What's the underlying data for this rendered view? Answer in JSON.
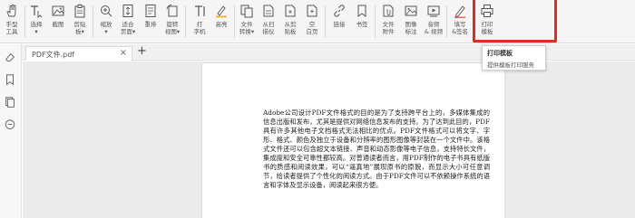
{
  "toolbar": {
    "hand_label": "手型\n工具",
    "select_label": "选择\n▾",
    "screenshot_label": "截图",
    "clipboard_label": "剪贴\n板▾",
    "zoom_label": "缩放\n▾",
    "fitpage_label": "适合\n页面▾",
    "reflow_label": "重排",
    "rotate_label": "旋转\n视图▾",
    "typewriter_label": "打\n字机",
    "highlight_label": "高亮",
    "convert_label": "文件\n转换▾",
    "from_scanner_label": "从扫\n描仪",
    "from_clipboard_label": "从剪\n贴板",
    "blank_page_label": "空\n白页",
    "link_label": "链接",
    "bookmark_label": "书签",
    "attach_label": "文件\n附件",
    "image_label": "图像\n标注",
    "audio_video_label": "音频\n& 视频",
    "sign_label": "填写\n&签名",
    "print_template_label": "打印\n模板"
  },
  "tabs": {
    "file_name": "PDF文件.pdf",
    "close": "×",
    "add": "+"
  },
  "tooltip": {
    "title": "打印模板",
    "description": "提供模板打印服务"
  },
  "document": {
    "body": "Adobe公司设计PDF文件格式的目的是为了支持跨平台上的，多媒体集成的信息出版和发布，尤其是提供对网络信息发布的支持。为了达到此目的，PDF具有许多其他电子文档格式无法相比的优点。PDF文件格式可以将文字、字形、格式、颜色及独立于设备和分辨率的图形图像等封装在一个文件中。该格式文件还可以包含超文本链接、声音和动态影像等电子信息，支持特长文件，集成度和安全可靠性都较高。对普通读者而言，用PDF制作的电子书具有纸版书的质感和阅读效果，可以“逼真地”展现原书的原貌，而显示大小可任意调节，给读者提供了个性化的阅读方式。由于PDF文件可以不依赖操作系统的语言和字体及显示设备，阅读起来很方便。"
  },
  "colors": {
    "highlight_border": "#e02b1f",
    "icon_stroke": "#555555",
    "accent_yellow": "#f2b01e"
  }
}
